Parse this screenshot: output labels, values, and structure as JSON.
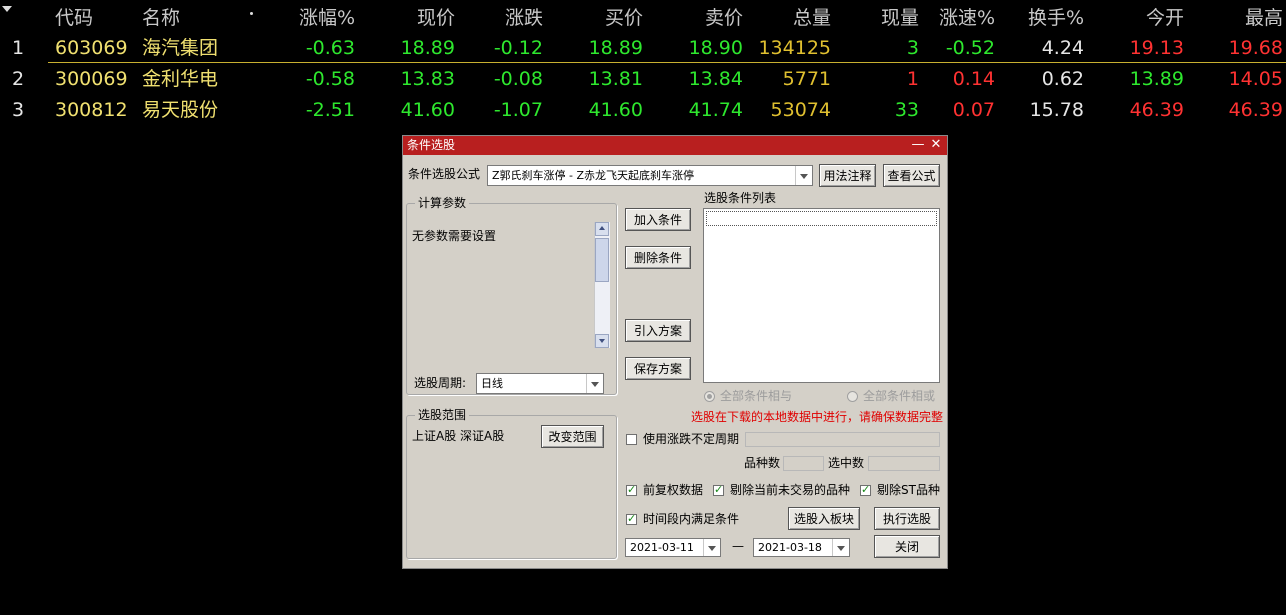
{
  "table": {
    "sort_icon": "sort-desc-icon",
    "headers": [
      "代码",
      "名称",
      "涨幅%",
      "现价",
      "涨跌",
      "买价",
      "卖价",
      "总量",
      "现量",
      "涨速%",
      "换手%",
      "今开",
      "最高"
    ],
    "rows": [
      {
        "idx": "1",
        "code": "603069",
        "name": "海汽集团",
        "chg_pct": "-0.63",
        "price": "18.89",
        "chg": "-0.12",
        "bid": "18.89",
        "ask": "18.90",
        "vol": "134125",
        "cur_vol": "3",
        "speed": "-0.52",
        "turnover": "4.24",
        "open": "19.13",
        "high": "19.68"
      },
      {
        "idx": "2",
        "code": "300069",
        "name": "金利华电",
        "chg_pct": "-0.58",
        "price": "13.83",
        "chg": "-0.08",
        "bid": "13.81",
        "ask": "13.84",
        "vol": "5771",
        "cur_vol": "1",
        "speed": "0.14",
        "turnover": "0.62",
        "open": "13.89",
        "high": "14.05"
      },
      {
        "idx": "3",
        "code": "300812",
        "name": "易天股份",
        "chg_pct": "-2.51",
        "price": "41.60",
        "chg": "-1.07",
        "bid": "41.60",
        "ask": "41.74",
        "vol": "53074",
        "cur_vol": "33",
        "speed": "0.07",
        "turnover": "15.78",
        "open": "46.39",
        "high": "46.39"
      }
    ]
  },
  "dialog": {
    "title": "条件选股",
    "min_icon": "—",
    "close_icon": "✕",
    "formula_label": "条件选股公式",
    "formula_value": "Z郭氏刹车涨停 - Z赤龙飞天起底刹车涨停",
    "usage_btn": "用法注释",
    "view_btn": "查看公式",
    "params_group": "计算参数",
    "params_text": "无参数需要设置",
    "period_label": "选股周期:",
    "period_value": "日线",
    "scope_group": "选股范围",
    "scope_text": "上证A股 深证A股",
    "change_scope_btn": "改变范围",
    "add_cond_btn": "加入条件",
    "del_cond_btn": "删除条件",
    "import_btn": "引入方案",
    "save_btn": "保存方案",
    "cond_list_label": "选股条件列表",
    "radio_and": "全部条件相与",
    "radio_or": "全部条件相或",
    "warning": "选股在下载的本地数据中进行，请确保数据完整",
    "use_period_label": "使用涨跌不定周期",
    "count_label": "品种数",
    "selected_label": "选中数",
    "chk_fq": "前复权数据",
    "chk_exclude_notrade": "剔除当前未交易的品种",
    "chk_exclude_st": "剔除ST品种",
    "chk_time_range": "时间段内满足条件",
    "to_block_btn": "选股入板块",
    "run_btn": "执行选股",
    "close_btn": "关闭",
    "date_from": "2021-03-11",
    "date_sep": "—",
    "date_to": "2021-03-18"
  }
}
